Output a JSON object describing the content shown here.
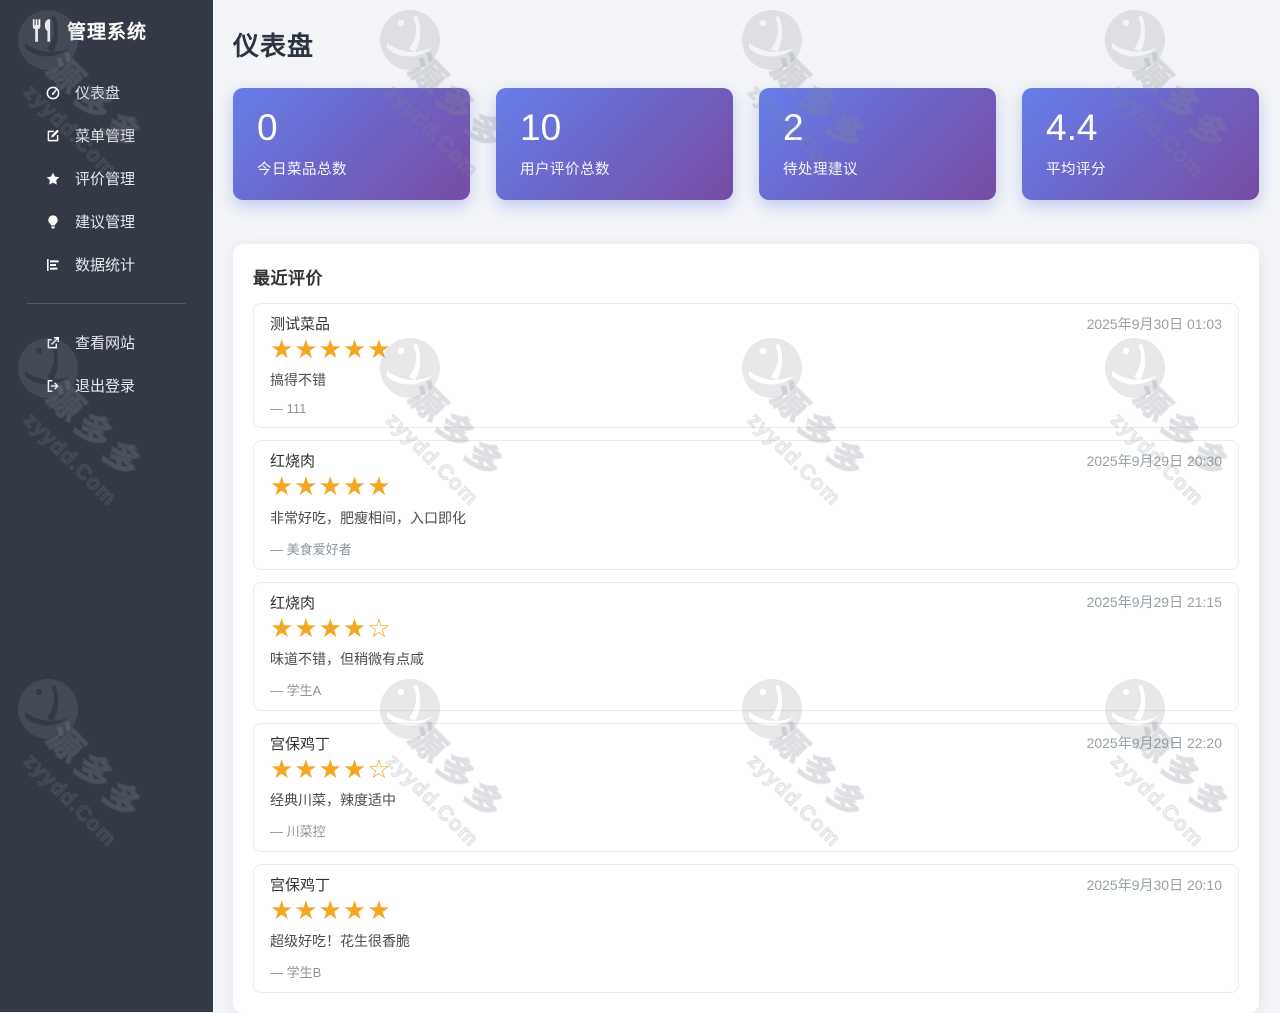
{
  "sidebar": {
    "title": "管理系统",
    "logo_icon": "utensils-icon",
    "menu": [
      {
        "key": "dashboard",
        "label": "仪表盘",
        "icon": "gauge-icon"
      },
      {
        "key": "menu-manage",
        "label": "菜单管理",
        "icon": "edit-icon"
      },
      {
        "key": "review-manage",
        "label": "评价管理",
        "icon": "star-icon"
      },
      {
        "key": "suggest-manage",
        "label": "建议管理",
        "icon": "lightbulb-icon"
      },
      {
        "key": "data-stats",
        "label": "数据统计",
        "icon": "bar-chart-icon"
      }
    ],
    "links": [
      {
        "key": "view-site",
        "label": "查看网站",
        "icon": "external-link-icon"
      },
      {
        "key": "logout",
        "label": "退出登录",
        "icon": "logout-icon"
      }
    ]
  },
  "header": {
    "title": "仪表盘"
  },
  "stats": [
    {
      "value": "0",
      "label": "今日菜品总数"
    },
    {
      "value": "10",
      "label": "用户评价总数"
    },
    {
      "value": "2",
      "label": "待处理建议"
    },
    {
      "value": "4.4",
      "label": "平均评分"
    }
  ],
  "reviews": {
    "title": "最近评价",
    "max_rating": 5,
    "items": [
      {
        "dish": "测试菜品",
        "rating": 5,
        "date": "2025年9月30日 01:03",
        "comment": "搞得不错",
        "author": "— 111"
      },
      {
        "dish": "红烧肉",
        "rating": 5,
        "date": "2025年9月29日 20:30",
        "comment": "非常好吃，肥瘦相间，入口即化",
        "author": "— 美食爱好者"
      },
      {
        "dish": "红烧肉",
        "rating": 4,
        "date": "2025年9月29日 21:15",
        "comment": "味道不错，但稍微有点咸",
        "author": "— 学生A"
      },
      {
        "dish": "宫保鸡丁",
        "rating": 4,
        "date": "2025年9月29日 22:20",
        "comment": "经典川菜，辣度适中",
        "author": "— 川菜控"
      },
      {
        "dish": "宫保鸡丁",
        "rating": 5,
        "date": "2025年9月30日 20:10",
        "comment": "超级好吃！花生很香脆",
        "author": "— 学生B"
      }
    ]
  },
  "watermark": {
    "text_cn": "源多多",
    "text_en": "zyydd.Com"
  },
  "colors": {
    "grad1": "#667eea",
    "grad2": "#764ba2",
    "star": "#f5a623",
    "sidebar_bg": "#343a45",
    "page_bg": "#f3f4f7"
  }
}
